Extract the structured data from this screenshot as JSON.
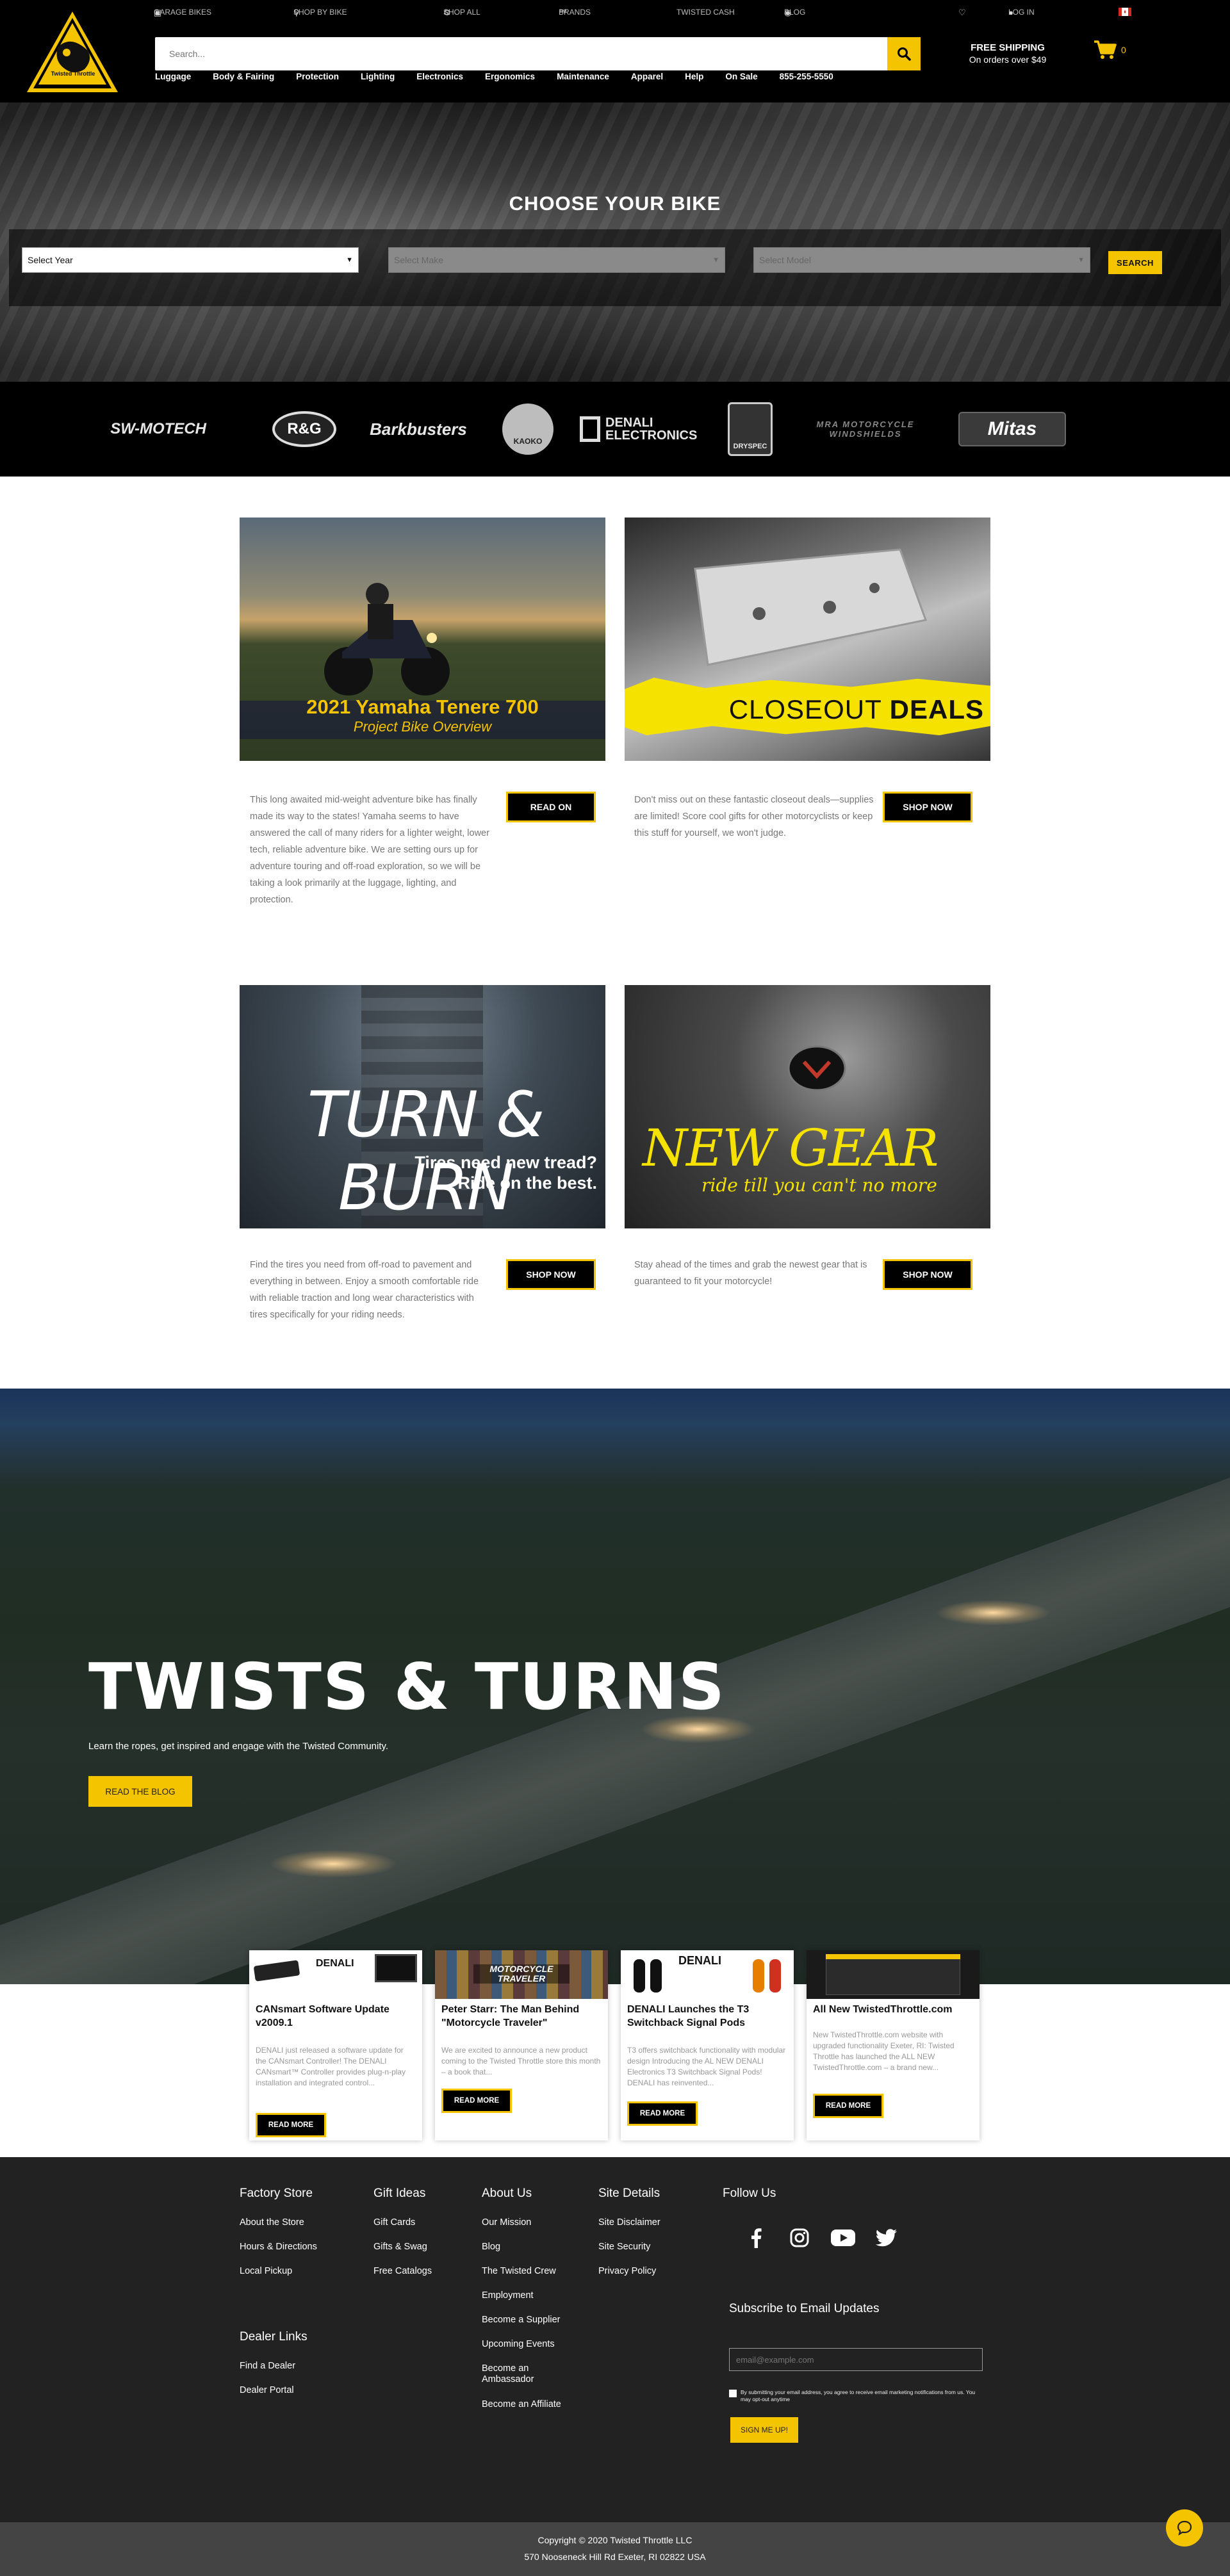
{
  "header": {
    "logo_text": "Twisted Throttle",
    "top_links": {
      "garage": "GARAGE BIKES",
      "shop_by_bike": "SHOP BY BIKE",
      "shop_all": "SHOP ALL",
      "brands": "BRANDS",
      "twisted_cash": "TWISTED CASH",
      "blog": "BLOG",
      "login": "LOG IN"
    },
    "search_placeholder": "Search...",
    "nav": [
      "Luggage",
      "Body & Fairing",
      "Protection",
      "Lighting",
      "Electronics",
      "Ergonomics",
      "Maintenance",
      "Apparel",
      "Help",
      "On Sale",
      "855-255-5550"
    ],
    "shipping_title": "FREE SHIPPING",
    "shipping_sub": "On orders over $49",
    "cart_count": "0"
  },
  "hero": {
    "title": "CHOOSE YOUR BIKE",
    "year_select": "Select Year",
    "make_select": "Select Make",
    "model_select": "Select Model",
    "search_button": "SEARCH"
  },
  "brands": [
    "SW-MOTECH",
    "R&G",
    "Barkbusters",
    "KAOKO",
    "DENALI ELECTRONICS",
    "DRYSPEC",
    "MRA MOTORCYCLE WINDSHIELDS",
    "Mitas"
  ],
  "promos": [
    {
      "image_title": "2021 Yamaha Tenere 700",
      "image_subtitle": "Project Bike Overview",
      "text": "This long awaited mid-weight adventure bike has finally made its way to the states! Yamaha seems to have answered the call of many riders for a lighter weight, lower tech, reliable adventure bike. We are setting ours up for adventure touring and off-road exploration, so we will be taking a look primarily at the luggage, lighting, and protection.",
      "button": "READ ON"
    },
    {
      "image_title_a": "CLOSEOUT ",
      "image_title_b": "DEALS",
      "text": "Don't miss out on these fantastic closeout deals—supplies are limited! Score cool gifts for other motorcyclists or keep this stuff for yourself, we won't judge.",
      "button": "SHOP NOW"
    },
    {
      "image_title": "TURN & BURN",
      "image_subtitle_1": "Tires need new tread?",
      "image_subtitle_2": "Ride on the best.",
      "text": "Find the tires you need from off-road to pavement and everything in between. Enjoy a smooth comfortable ride with reliable traction and long wear characteristics with tires specifically for your riding needs.",
      "button": "SHOP NOW"
    },
    {
      "image_title": "NEW GEAR",
      "image_subtitle": "ride till you can't no more",
      "text": "Stay ahead of the times and grab the newest gear that is guaranteed to fit your motorcycle!",
      "button": "SHOP NOW"
    }
  ],
  "twists": {
    "title": "TWISTS & TURNS",
    "subtitle": "Learn the ropes, get inspired and engage with the Twisted Community.",
    "button": "READ THE BLOG"
  },
  "blog_cards": [
    {
      "img_label": "DENALI",
      "title": "CANsmart Software Update v2009.1",
      "excerpt": "DENALI just released a software update for the CANsmart Controller!  The DENALI CANsmart™ Controller provides plug-n-play installation and integrated control...",
      "button": "READ MORE"
    },
    {
      "img_label": "MOTORCYCLE TRAVELER",
      "title": "Peter Starr: The Man Behind \"Motorcycle Traveler\"",
      "excerpt": "We are excited to announce a new product coming to the Twisted Throttle store this month – a book that...",
      "button": "READ MORE"
    },
    {
      "img_label": "DENALI",
      "title": "DENALI Launches the T3 Switchback Signal Pods",
      "excerpt": "T3 offers switchback functionality with modular design Introducing the AL NEW DENALI Electronics T3 Switchback Signal Pods! DENALI has reinvented...",
      "button": "READ MORE"
    },
    {
      "img_label": "",
      "title": "All New TwistedThrottle.com",
      "excerpt": "New TwistedThrottle.com website with upgraded functionality Exeter, RI: Twisted Throttle has launched the ALL NEW TwistedThrottle.com – a brand new...",
      "button": "READ MORE"
    }
  ],
  "footer": {
    "factory_store": {
      "title": "Factory Store",
      "items": [
        "About the Store",
        "Hours & Directions",
        "Local Pickup"
      ]
    },
    "gift_ideas": {
      "title": "Gift Ideas",
      "items": [
        "Gift Cards",
        "Gifts & Swag",
        "Free Catalogs"
      ]
    },
    "about_us": {
      "title": "About Us",
      "items": [
        "Our Mission",
        "Blog",
        "The Twisted Crew",
        "Employment",
        "Become a Supplier",
        "Upcoming Events",
        "Become an Ambassador",
        "Become an Affiliate"
      ]
    },
    "site_details": {
      "title": "Site Details",
      "items": [
        "Site Disclaimer",
        "Site Security",
        "Privacy Policy"
      ]
    },
    "dealer_links": {
      "title": "Dealer Links",
      "items": [
        "Find a Dealer",
        "Dealer Portal"
      ]
    },
    "follow_us": "Follow Us",
    "subscribe_title": "Subscribe to Email Updates",
    "email_placeholder": "email@example.com",
    "consent": "By submitting your email address, you agree to receive email marketing notifications from us. You may opt-out anytime",
    "signup_button": "SIGN ME UP!",
    "copyright": "Copyright © 2020 Twisted Throttle LLC",
    "address": "570 Nooseneck Hill Rd Exeter, RI 02822 USA"
  },
  "colors": {
    "accent": "#f5c400",
    "dark": "#000000",
    "footer": "#222222"
  }
}
